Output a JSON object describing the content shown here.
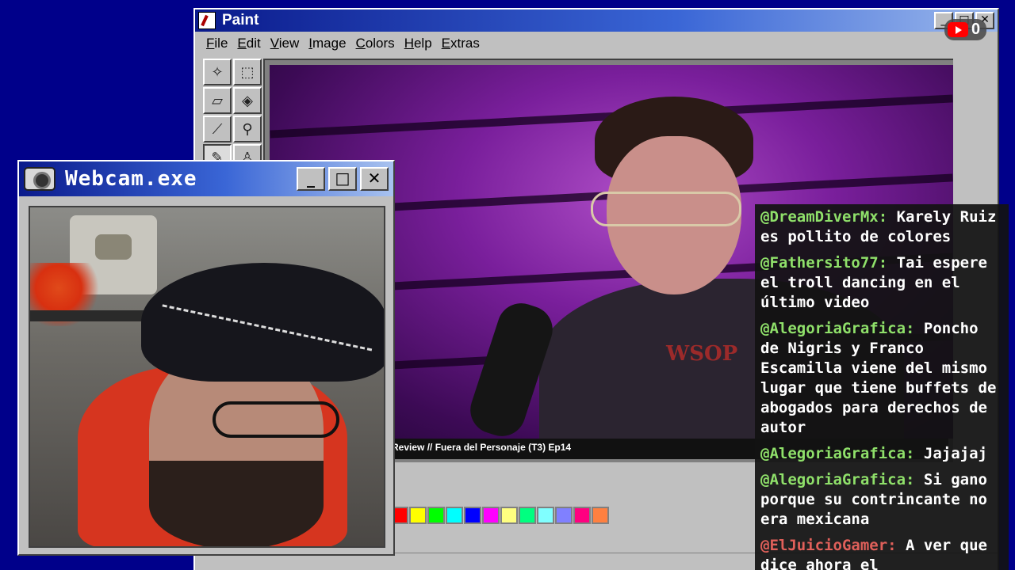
{
  "paint": {
    "title": "Paint",
    "menu": [
      "File",
      "Edit",
      "View",
      "Image",
      "Colors",
      "Help",
      "Extras"
    ],
    "video_caption": "Review // Fuera del Personaje (T3) Ep14",
    "shirt_text": "WSOP",
    "palette": [
      "#004040",
      "#1e90ff",
      "#004c8a",
      "#3a1fd6",
      "#804000",
      "#ffffff",
      "#c0c0c0",
      "#ff0000",
      "#ffff00",
      "#00ff00",
      "#00ffff",
      "#0000ff",
      "#ff00ff",
      "#ffff80",
      "#00ff80",
      "#80ffff",
      "#8080ff",
      "#ff0080",
      "#ff8040"
    ]
  },
  "youtube_badge": {
    "count": "0",
    "icon": "youtube-icon"
  },
  "webcam": {
    "title": "Webcam.exe",
    "icon": "camera-icon"
  },
  "chat": {
    "messages": [
      {
        "user": "@DreamDiverMx:",
        "text": "Karely Ruiz es pollito de colores"
      },
      {
        "user": "@Fathersito77:",
        "text": "Tai espere el troll dancing en el último video"
      },
      {
        "user": "@AlegoriaGrafica:",
        "text": "Poncho de Nigris y Franco Escamilla viene del mismo lugar que tiene buffets de abogados para derechos de autor"
      },
      {
        "user": "@AlegoriaGrafica:",
        "text": "Jajajaj"
      },
      {
        "user": "@AlegoriaGrafica:",
        "text": "Si gano porque su contrincante no era mexicana"
      },
      {
        "user": "@ElJuicioGamer:",
        "text": "A ver que dice ahora el",
        "user_color": "red"
      }
    ]
  }
}
